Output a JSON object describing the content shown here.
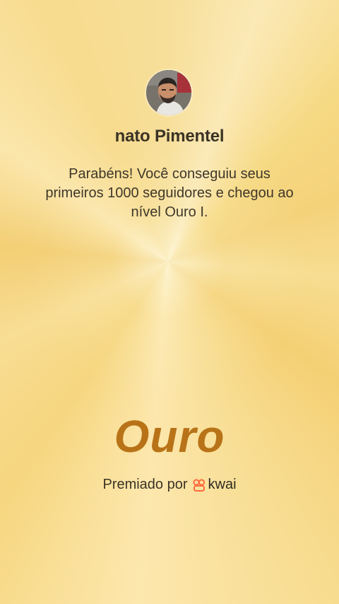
{
  "profile": {
    "username": "nato Pimentel",
    "avatar_icon": "user-avatar-photo"
  },
  "message": "Parabéns! Você conseguiu seus primeiros 1000 seguidores e chegou ao nível Ouro I.",
  "tier": {
    "name": "Ouro",
    "color": "#b87318"
  },
  "footer": {
    "awarded_by": "Premiado por",
    "brand_name": "kwai",
    "brand_icon": "kwai-logo-icon",
    "brand_color": "#ff6a3d"
  },
  "background": {
    "style": "gold radial burst",
    "colors": [
      "#f7df9a",
      "#fbe9b6",
      "#f4d27a"
    ]
  }
}
